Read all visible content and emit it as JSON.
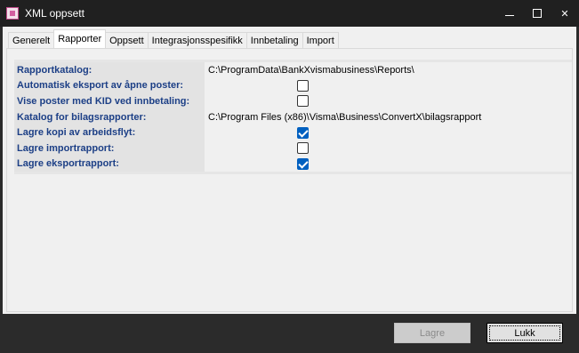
{
  "window": {
    "title": "XML oppsett",
    "controls": {
      "minimize": "minimize",
      "maximize": "maximize",
      "close": "✕"
    }
  },
  "tabs": [
    {
      "label": "Generelt",
      "active": false
    },
    {
      "label": "Rapporter",
      "active": true
    },
    {
      "label": "Oppsett",
      "active": false
    },
    {
      "label": "Integrasjonsspesifikk",
      "active": false
    },
    {
      "label": "Innbetaling",
      "active": false
    },
    {
      "label": "Import",
      "active": false
    }
  ],
  "settings": [
    {
      "label": "Rapportkatalog:",
      "type": "text",
      "value": "C:\\ProgramData\\BankXvismabusiness\\Reports\\"
    },
    {
      "label": "Automatisk eksport av åpne poster:",
      "type": "checkbox",
      "checked": false
    },
    {
      "label": "Vise poster med KID ved innbetaling:",
      "type": "checkbox",
      "checked": false
    },
    {
      "label": "Katalog for bilagsrapporter:",
      "type": "text",
      "value": "C:\\Program Files (x86)\\Visma\\Business\\ConvertX\\bilagsrapport"
    },
    {
      "label": "Lagre kopi av arbeidsflyt:",
      "type": "checkbox",
      "checked": true
    },
    {
      "label": "Lagre importrapport:",
      "type": "checkbox",
      "checked": false
    },
    {
      "label": "Lagre eksportrapport:",
      "type": "checkbox",
      "checked": true
    }
  ],
  "buttons": {
    "save_label": "Lagre",
    "save_enabled": false,
    "close_label": "Lukk"
  },
  "colors": {
    "label_text": "#1c3f86",
    "checkbox_checked": "#0060c0",
    "titlebar": "#202020"
  }
}
